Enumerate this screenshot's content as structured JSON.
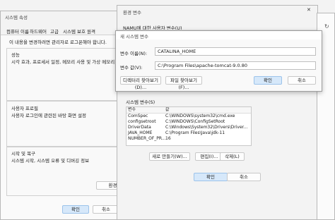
{
  "sysprops": {
    "title": "시스템 속성",
    "tabs": [
      "컴퓨터 이름",
      "하드웨어",
      "고급",
      "시스템 보호",
      "원격"
    ],
    "admin_note": "이 내용을 변경하려면 관리자로 로그온해야 합니다.",
    "perf_title": "성능",
    "perf_desc": "시각 효과, 프로세서 일정, 메모리 사용 및 가상 메모리",
    "profile_title": "사용자 프로필",
    "profile_desc": "사용자 로그인에 관련된 바탕 화면 설정",
    "startup_title": "시작 및 복구",
    "startup_desc": "시스템 시작, 시스템 오류 및 디버깅 정보",
    "envvars_button": "환경 변",
    "ok": "확인",
    "cancel": "취소"
  },
  "envvars": {
    "title": "환경 변수",
    "user_vars_label": "NAMU에 대한 사용자 변수(U)",
    "system_vars_label": "시스템 변수(S)",
    "col_var": "변수",
    "col_value": "값",
    "rows": [
      {
        "name": "ComSpec",
        "value": "C:\\WINDOWS\\system32\\cmd.exe"
      },
      {
        "name": "configsetroot",
        "value": "C:\\WINDOWS\\ConfigSetRoot"
      },
      {
        "name": "DriverData",
        "value": "C:\\Windows\\System32\\Drivers\\Driver..."
      },
      {
        "name": "JAVA_HOME",
        "value": "C:\\Program Files\\Java\\jdk-11"
      },
      {
        "name": "NUMBER_OF_PR...",
        "value": "16"
      }
    ],
    "new_button": "새로 만들기(W)...",
    "edit_button": "편집(I)...",
    "delete_button": "삭제(L)",
    "ok": "확인",
    "cancel": "취소"
  },
  "newvar": {
    "title": "새 시스템 변수",
    "name_label": "변수 이름(N):",
    "name_value": "CATALINA_HOME",
    "value_label": "변수 값(V):",
    "value_value": "C:\\Program Files\\apache-tomcat-9.0.80",
    "browse_dir": "디렉터리 찾아보기(D)...",
    "browse_file": "파일 찾아보기(F)...",
    "ok": "확인",
    "cancel": "취소"
  }
}
